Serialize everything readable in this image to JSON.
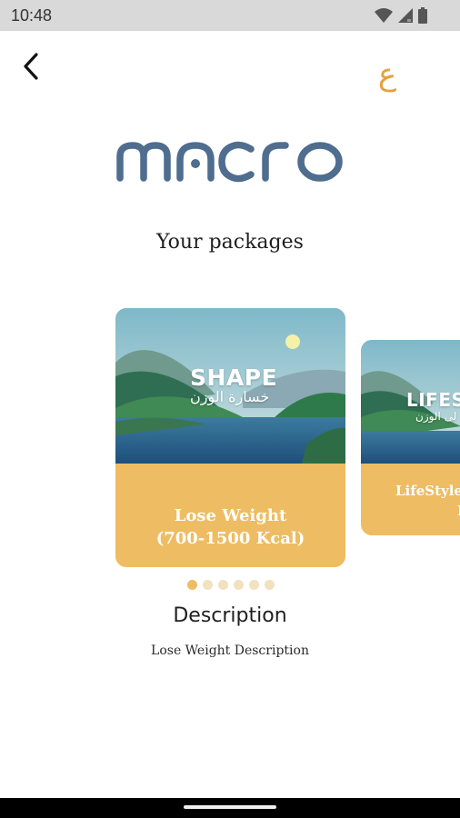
{
  "status_bar": {
    "time": "10:48",
    "icons": [
      "wifi-icon",
      "cellular-signal-icon",
      "battery-icon"
    ]
  },
  "header": {
    "back_icon": "back-arrow-icon",
    "language_toggle": "ع"
  },
  "logo": {
    "text": "macro",
    "color": "#4f6d8e"
  },
  "title": "Your packages",
  "packages": [
    {
      "image_title": "SHAPE",
      "image_subtitle": "خسارة الوزن",
      "name_line1": "Lose Weight",
      "name_line2": "(700-1500 Kcal)"
    },
    {
      "image_title": "LIFES",
      "image_subtitle": "لى الوزن",
      "name_line1": "LifeStyle (",
      "name_line2": "Ka"
    }
  ],
  "pagination": {
    "count": 6,
    "active_index": 0
  },
  "description": {
    "heading": "Description",
    "text": "Lose Weight Description"
  },
  "colors": {
    "accent": "#eebc62",
    "accent_text": "#e5a13b",
    "logo": "#4f6d8e",
    "dot_inactive": "#f3e0bf"
  }
}
